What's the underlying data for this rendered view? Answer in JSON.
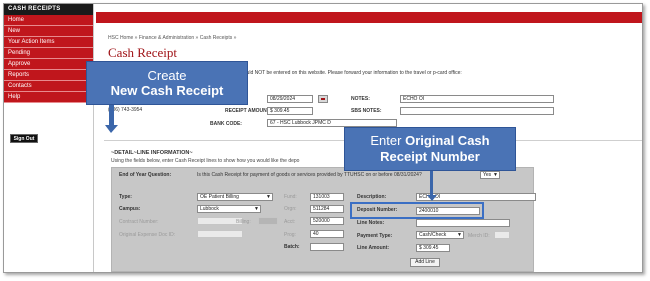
{
  "sidebar": {
    "title": "CASH RECEIPTS",
    "items": [
      "Home",
      "New",
      "Your Action Items",
      "Pending",
      "Approve",
      "Reports",
      "Contacts",
      "Help"
    ],
    "signout": "Sign Out"
  },
  "breadcrumb": "HSC Home  »  Finance & Administration  »  Cash Receipts  »",
  "page_title": "Cash Receipt",
  "notice": "hould NOT be entered on this website. Please forward your information to the travel or p-card office:",
  "phone": "(806) 743-3954",
  "header_form": {
    "date_value": "08/29/2024",
    "amount_label": "RECEIPT AMOUNT:",
    "amount_value": "$ 309.45",
    "notes_label": "NOTES:",
    "notes_value": "ECHO OI",
    "sbs_notes_label": "SBS NOTES:",
    "bank_code_label": "BANK CODE:",
    "bank_code_value": "67 - HSC Lubbock JPMC D"
  },
  "detail": {
    "title": "~DETAIL~LINE INFORMATION~",
    "subtitle": "Using the fields below, enter Cash Receipt lines to show how you would like the depo",
    "eoy_label": "End of Year Question:",
    "eoy_question": "Is this Cash Receipt for payment of goods or services provided by TTUHSC on or before 08/31/2024?",
    "eoy_value": "Yes",
    "type_label": "Type:",
    "type_value": "OE Patient Billing",
    "campus_label": "Campus:",
    "campus_value": "Lubbock",
    "contract_label": "Contract Number:",
    "billing_label": "Billing:",
    "orig_expense_label": "Original Expense Doc ID:",
    "fund_label": "Fund:",
    "fund_value": "131003",
    "orgn_label": "Orgn:",
    "orgn_value": "511284",
    "acct_label": "Acct:",
    "acct_value": "520000",
    "prog_label": "Prog:",
    "prog_value": "40",
    "batch_label": "Batch:",
    "description_label": "Description:",
    "description_value": "ECHO OI",
    "deposit_label": "Deposit Number:",
    "deposit_value": "2400010",
    "line_notes_label": "Line Notes:",
    "payment_type_label": "Payment Type:",
    "payment_type_value": "Cash/Check",
    "merch_label": "Merch ID:",
    "line_amount_label": "Line Amount:",
    "line_amount_value": "$ 309.45",
    "add_line": "Add Line"
  },
  "callouts": {
    "create_line1": "Create",
    "create_line2": "New Cash Receipt",
    "enter_line1": "Enter",
    "enter_line1_bold": "Original Cash",
    "enter_line2": "Receipt Number"
  },
  "colors": {
    "accent_red": "#c0161c",
    "callout_blue": "#4a73b5",
    "highlight_blue": "#3b6fc4"
  }
}
